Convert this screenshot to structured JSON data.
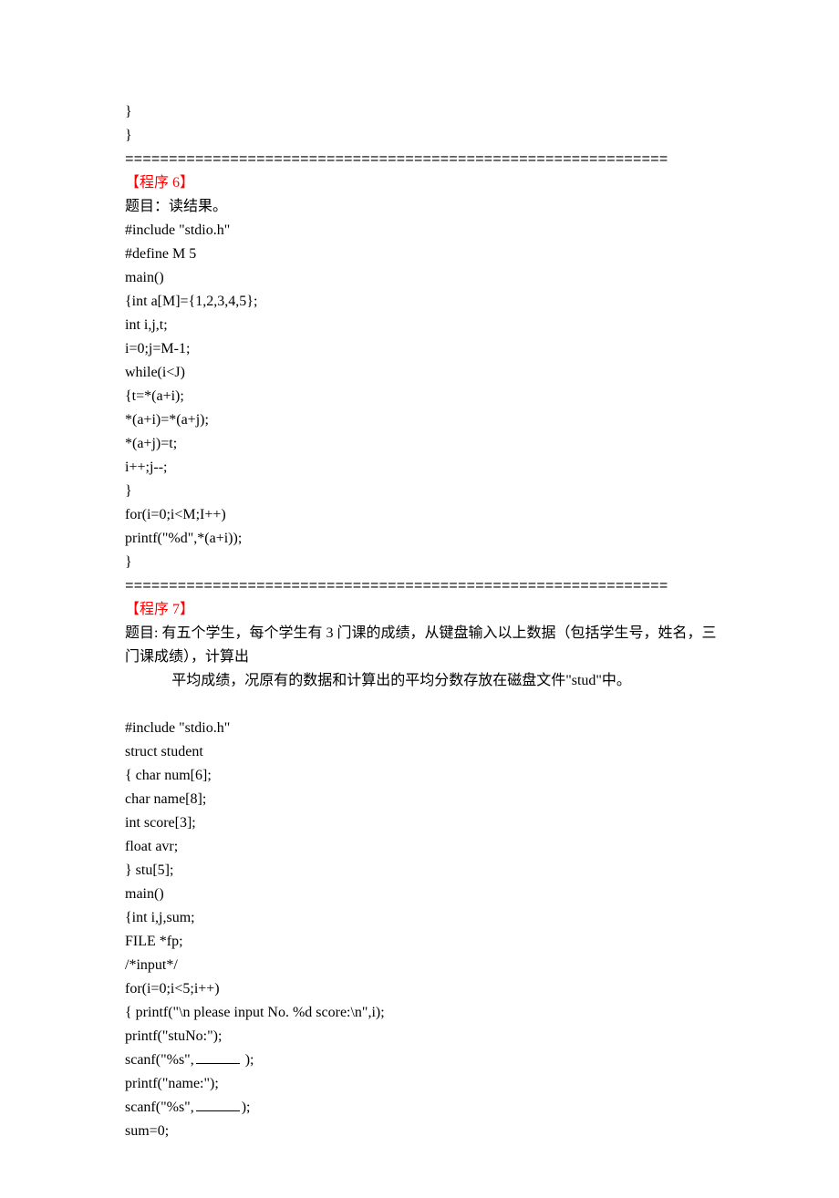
{
  "separator": "==============================================================",
  "block1": {
    "lines": [
      "}",
      "}"
    ]
  },
  "prog6": {
    "heading": "【程序 6】",
    "title": "题目：读结果。",
    "code": [
      "#include \"stdio.h\"",
      "#define M 5",
      "main()",
      "{int a[M]={1,2,3,4,5};",
      "int i,j,t;",
      "i=0;j=M-1;",
      "while(i<J)",
      "{t=*(a+i);",
      "*(a+i)=*(a+j);",
      "*(a+j)=t;",
      "i++;j--;",
      "}",
      "for(i=0;i<M;I++)",
      "printf(\"%d\",*(a+i));",
      "}"
    ]
  },
  "prog7": {
    "heading": "【程序 7】",
    "title1": "题目: 有五个学生，每个学生有 3 门课的成绩，从键盘输入以上数据（包括学生号，姓名，三门课成绩），计算出",
    "title2": "平均成绩，况原有的数据和计算出的平均分数存放在磁盘文件\"stud\"中。",
    "code": [
      "#include \"stdio.h\"",
      "struct student",
      "{ char num[6];",
      "char name[8];",
      "int score[3];",
      "float avr;",
      "} stu[5];",
      "main()",
      "{int i,j,sum;",
      "FILE *fp;",
      "/*input*/",
      "for(i=0;i<5;i++)",
      "{ printf(\"\\n please input No. %d score:\\n\",i);",
      "printf(\"stuNo:\");"
    ],
    "scanf1_pre": "scanf(\"%s\",",
    "scanf1_post": " );",
    "mid": [
      "printf(\"name:\");"
    ],
    "scanf2_pre": "scanf(\"%s\",",
    "scanf2_post": ");",
    "tail": [
      "sum=0;"
    ]
  }
}
